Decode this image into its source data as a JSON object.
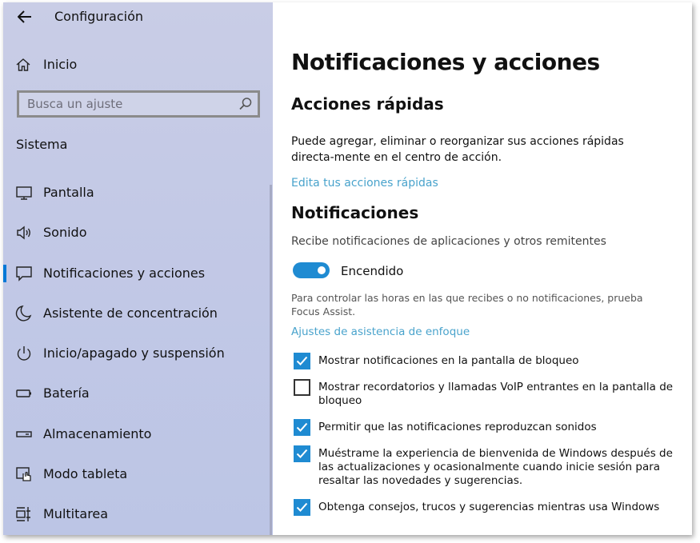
{
  "app": {
    "title": "Configuración"
  },
  "sidebar": {
    "home_label": "Inicio",
    "search_placeholder": "Busca un ajuste",
    "section_label": "Sistema",
    "items": [
      {
        "label": "Pantalla",
        "icon": "monitor-icon"
      },
      {
        "label": "Sonido",
        "icon": "speaker-icon"
      },
      {
        "label": "Notificaciones y acciones",
        "icon": "notification-icon",
        "active": true
      },
      {
        "label": "Asistente de concentración",
        "icon": "moon-icon"
      },
      {
        "label": "Inicio/apagado y suspensión",
        "icon": "power-icon"
      },
      {
        "label": "Batería",
        "icon": "battery-icon"
      },
      {
        "label": "Almacenamiento",
        "icon": "storage-icon"
      },
      {
        "label": "Modo tableta",
        "icon": "tablet-icon"
      },
      {
        "label": "Multitarea",
        "icon": "multitask-icon"
      }
    ]
  },
  "main": {
    "title": "Notificaciones y acciones",
    "quick_actions": {
      "heading": "Acciones rápidas",
      "description": "Puede agregar, eliminar o reorganizar sus acciones rápidas directa-mente en el centro de acción.",
      "link": "Edita tus acciones rápidas"
    },
    "notifications": {
      "heading": "Notificaciones",
      "subtitle": "Recibe notificaciones de aplicaciones y otros remitentes",
      "toggle_label": "Encendido",
      "toggle_on": true,
      "note": "Para controlar las horas en las que recibes o no notificaciones, prueba Focus Assist.",
      "focus_link": "Ajustes de asistencia de enfoque",
      "options": [
        {
          "label": "Mostrar notificaciones en la pantalla de bloqueo",
          "checked": true
        },
        {
          "label": "Mostrar recordatorios y llamadas VoIP entrantes en la pantalla de bloqueo",
          "checked": false
        },
        {
          "label": "Permitir que las notificaciones reproduzcan sonidos",
          "checked": true
        },
        {
          "label": "Muéstrame la experiencia de bienvenida de Windows después de las actualizaciones y ocasionalmente cuando inicie sesión para resaltar las novedades y sugerencias.",
          "checked": true
        },
        {
          "label": "Obtenga consejos, trucos y sugerencias mientras usa Windows",
          "checked": true
        }
      ]
    }
  },
  "colors": {
    "accent": "#1f8bd2",
    "link": "#49a3cc",
    "sidebar_bg": "#c3c9e6"
  }
}
